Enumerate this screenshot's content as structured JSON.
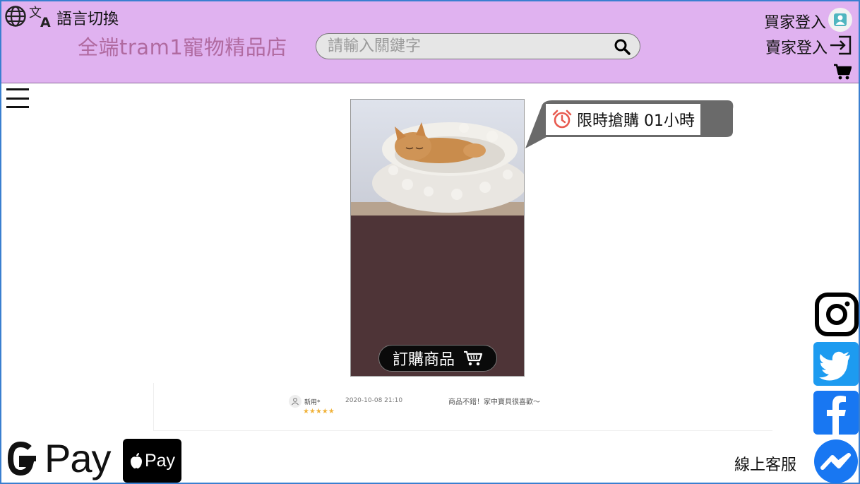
{
  "header": {
    "language_label": "語言切換",
    "brand": "全端tram1寵物精品店",
    "search_placeholder": "請輸入關鍵字",
    "buyer_login": "買家登入",
    "seller_login": "賣家登入"
  },
  "product": {
    "flash_sale": "限時搶購 01小時",
    "order_button": "訂購商品"
  },
  "review": {
    "user": "新用*",
    "date": "2020-10-08 21:10",
    "stars": "★★★★★",
    "text": "商品不錯！家中寶貝很喜歡～"
  },
  "payments": {
    "gpay": "Pay",
    "applepay": "Pay"
  },
  "support": {
    "label": "線上客服"
  },
  "colors": {
    "header_bg": "#e0b2f0",
    "brand": "#b06aa0",
    "card_bg": "#4e3437",
    "twitter": "#1d9bf0",
    "facebook": "#1877f2"
  }
}
